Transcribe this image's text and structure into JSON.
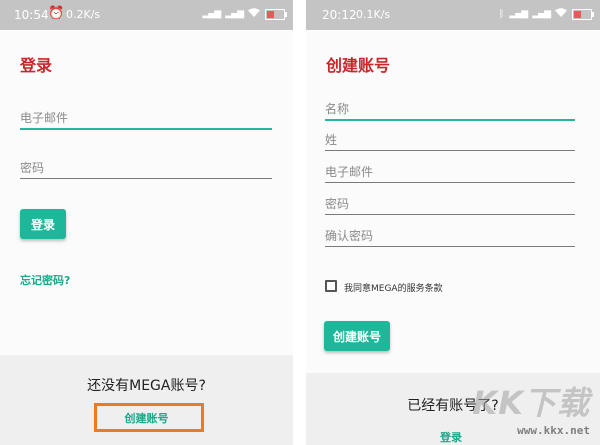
{
  "left_screen": {
    "status": {
      "time": "10:54",
      "speed": "0.2K/s"
    },
    "title": "登录",
    "email_placeholder": "电子邮件",
    "password_placeholder": "密码",
    "login_button": "登录",
    "forgot_password": "忘记密码?",
    "no_account_text": "还没有MEGA账号?",
    "create_account_link": "创建账号"
  },
  "right_screen": {
    "status": {
      "time": "20:12",
      "speed": "0.1K/s"
    },
    "title": "创建账号",
    "name_placeholder": "名称",
    "surname_placeholder": "姓",
    "email_placeholder": "电子邮件",
    "password_placeholder": "密码",
    "confirm_password_placeholder": "确认密码",
    "terms_prefix": "我同意MEGA的",
    "terms_link": "服务条款",
    "create_button": "创建账号",
    "have_account_text": "已经有账号了?",
    "login_link": "登录"
  },
  "watermark": {
    "logo_text": "KK下载",
    "url": "www.kkx.net"
  },
  "colors": {
    "accent": "#1fb799",
    "title_red": "#c6282b",
    "highlight_orange": "#ef7a1e",
    "status_bar": "#c4c4c4"
  },
  "icons": [
    "alarm-icon",
    "signal-icon",
    "wifi-icon",
    "battery-icon",
    "bluetooth-icon"
  ]
}
